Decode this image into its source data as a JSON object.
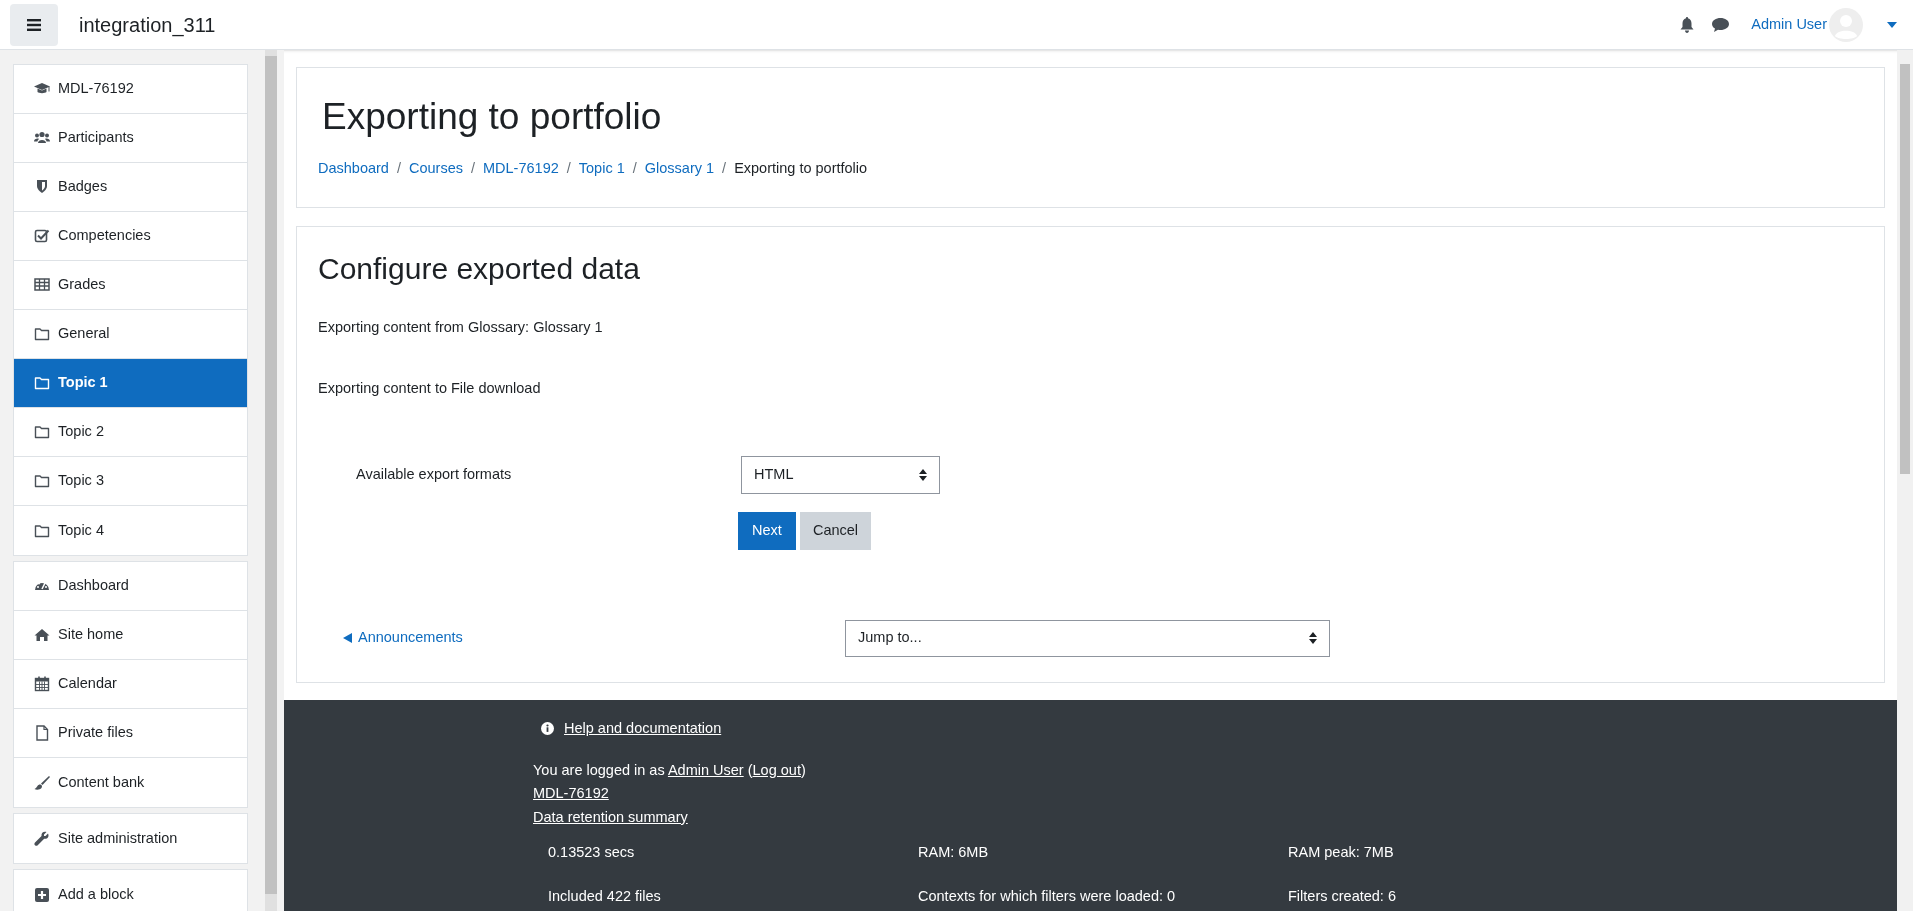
{
  "navbar": {
    "site_name": "integration_311",
    "user_name": "Admin User"
  },
  "sidebar": {
    "groups": [
      {
        "items": [
          {
            "label": "MDL-76192",
            "selected": false
          },
          {
            "label": "Participants",
            "selected": false
          },
          {
            "label": "Badges",
            "selected": false
          },
          {
            "label": "Competencies",
            "selected": false
          },
          {
            "label": "Grades",
            "selected": false
          },
          {
            "label": "General",
            "selected": false
          },
          {
            "label": "Topic 1",
            "selected": true
          },
          {
            "label": "Topic 2",
            "selected": false
          },
          {
            "label": "Topic 3",
            "selected": false
          },
          {
            "label": "Topic 4",
            "selected": false
          }
        ]
      },
      {
        "items": [
          {
            "label": "Dashboard",
            "selected": false
          },
          {
            "label": "Site home",
            "selected": false
          },
          {
            "label": "Calendar",
            "selected": false
          },
          {
            "label": "Private files",
            "selected": false
          },
          {
            "label": "Content bank",
            "selected": false
          }
        ]
      },
      {
        "items": [
          {
            "label": "Site administration",
            "selected": false
          }
        ]
      },
      {
        "items": [
          {
            "label": "Add a block",
            "selected": false
          }
        ]
      }
    ]
  },
  "page_header": {
    "title": "Exporting to portfolio",
    "separator": "/",
    "breadcrumb": [
      {
        "text": "Dashboard",
        "link": true
      },
      {
        "text": "Courses",
        "link": true
      },
      {
        "text": "MDL-76192",
        "link": true
      },
      {
        "text": "Topic 1",
        "link": true
      },
      {
        "text": "Glossary 1",
        "link": true
      },
      {
        "text": "Exporting to portfolio",
        "link": false
      }
    ]
  },
  "form": {
    "heading": "Configure exported data",
    "info": [
      "Exporting content from Glossary: Glossary 1",
      "Exporting content to File download"
    ],
    "format_label": "Available export formats",
    "format_value": "HTML",
    "buttons": [
      {
        "label": "Next",
        "kind": "primary"
      },
      {
        "label": "Cancel",
        "kind": "secondary"
      }
    ]
  },
  "activity_nav": {
    "previous_link": "Announcements",
    "jump_placeholder": "Jump to..."
  },
  "footer": {
    "help_link": "Help and documentation",
    "login": {
      "prefix": "You are logged in as ",
      "user_link": "Admin User",
      "between": " (",
      "logout_link": "Log out",
      "suffix": ")"
    },
    "links": [
      "MDL-76192",
      "Data retention summary"
    ],
    "stats": [
      [
        "0.13523 secs",
        "RAM: 6MB",
        "RAM peak: 7MB"
      ],
      [
        "Included 422 files",
        "Contexts for which filters were loaded: 0",
        "Filters created: 6"
      ]
    ]
  }
}
